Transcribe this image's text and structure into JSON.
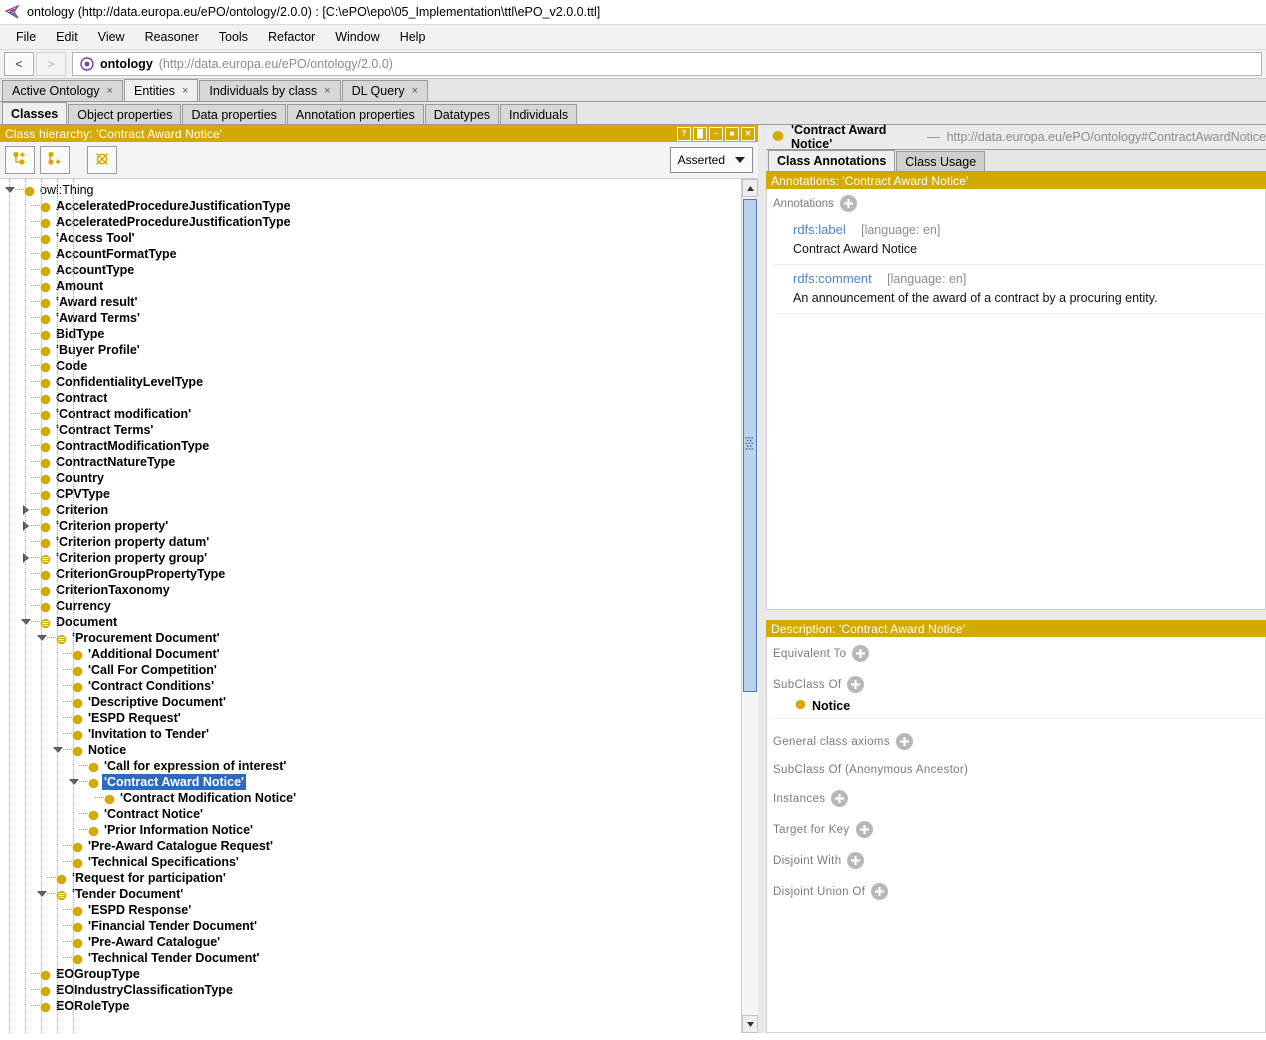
{
  "window": {
    "title": "ontology (http://data.europa.eu/ePO/ontology/2.0.0)  : [C:\\ePO\\epo\\05_Implementation\\ttl\\ePO_v2.0.0.ttl]",
    "logo_icon": "protege-logo-icon"
  },
  "menubar": [
    {
      "label": "File"
    },
    {
      "label": "Edit"
    },
    {
      "label": "View"
    },
    {
      "label": "Reasoner"
    },
    {
      "label": "Tools"
    },
    {
      "label": "Refactor"
    },
    {
      "label": "Window"
    },
    {
      "label": "Help"
    }
  ],
  "navbar": {
    "back_label": "<",
    "forward_label": ">",
    "ontology_icon": "ontology-icon",
    "ontology_name": "ontology",
    "ontology_iri": "(http://data.europa.eu/ePO/ontology/2.0.0)"
  },
  "main_tabs": [
    {
      "label": "Active Ontology",
      "close": "×",
      "selected": false
    },
    {
      "label": "Entities",
      "close": "×",
      "selected": true
    },
    {
      "label": "Individuals by class",
      "close": "×",
      "selected": false
    },
    {
      "label": "DL Query",
      "close": "×",
      "selected": false
    }
  ],
  "entity_tabs": [
    {
      "label": "Classes",
      "selected": true
    },
    {
      "label": "Object properties",
      "selected": false
    },
    {
      "label": "Data properties",
      "selected": false
    },
    {
      "label": "Annotation properties",
      "selected": false
    },
    {
      "label": "Datatypes",
      "selected": false
    },
    {
      "label": "Individuals",
      "selected": false
    }
  ],
  "hierarchy_panel": {
    "title": "Class hierarchy: 'Contract Award Notice'",
    "panel_buttons": [
      {
        "name": "help-button",
        "glyph": "?"
      },
      {
        "name": "split-button",
        "glyph": "▐▌"
      },
      {
        "name": "minimize-button",
        "glyph": "–"
      },
      {
        "name": "maximize-button",
        "glyph": "■"
      },
      {
        "name": "close-button",
        "glyph": "✕"
      }
    ],
    "toolbar": [
      {
        "name": "add-subclass-button",
        "icon": "add-subclass-icon"
      },
      {
        "name": "add-sibling-class-button",
        "icon": "add-sibling-class-icon"
      },
      {
        "name": "delete-class-button",
        "icon": "delete-class-icon"
      }
    ],
    "view_mode": "Asserted",
    "scrollbar": {
      "up_arrow": "▲",
      "down_arrow": "▼"
    }
  },
  "tree": [
    {
      "label": "owl:Thing",
      "depth": 0,
      "twisty": "open",
      "icon": "class-icon",
      "selected": false,
      "root": true
    },
    {
      "label": "AcceleratedProcedureJustificationType",
      "depth": 1,
      "twisty": "none",
      "icon": "class-icon",
      "selected": false
    },
    {
      "label": "AcceleratedProcedureJustificationType",
      "depth": 1,
      "twisty": "none",
      "icon": "class-icon",
      "selected": false
    },
    {
      "label": "'Access Tool'",
      "depth": 1,
      "twisty": "none",
      "icon": "class-icon",
      "selected": false
    },
    {
      "label": "AccountFormatType",
      "depth": 1,
      "twisty": "none",
      "icon": "class-icon",
      "selected": false
    },
    {
      "label": "AccountType",
      "depth": 1,
      "twisty": "none",
      "icon": "class-icon",
      "selected": false
    },
    {
      "label": "Amount",
      "depth": 1,
      "twisty": "none",
      "icon": "class-icon",
      "selected": false
    },
    {
      "label": "'Award result'",
      "depth": 1,
      "twisty": "none",
      "icon": "class-icon",
      "selected": false
    },
    {
      "label": "'Award Terms'",
      "depth": 1,
      "twisty": "none",
      "icon": "class-icon",
      "selected": false
    },
    {
      "label": "BidType",
      "depth": 1,
      "twisty": "none",
      "icon": "class-icon",
      "selected": false
    },
    {
      "label": "'Buyer Profile'",
      "depth": 1,
      "twisty": "none",
      "icon": "class-icon",
      "selected": false
    },
    {
      "label": "Code",
      "depth": 1,
      "twisty": "none",
      "icon": "class-icon",
      "selected": false
    },
    {
      "label": "ConfidentialityLevelType",
      "depth": 1,
      "twisty": "none",
      "icon": "class-icon",
      "selected": false
    },
    {
      "label": "Contract",
      "depth": 1,
      "twisty": "none",
      "icon": "class-icon",
      "selected": false
    },
    {
      "label": "'Contract modification'",
      "depth": 1,
      "twisty": "none",
      "icon": "class-icon",
      "selected": false
    },
    {
      "label": "'Contract Terms'",
      "depth": 1,
      "twisty": "none",
      "icon": "class-icon",
      "selected": false
    },
    {
      "label": "ContractModificationType",
      "depth": 1,
      "twisty": "none",
      "icon": "class-icon",
      "selected": false
    },
    {
      "label": "ContractNatureType",
      "depth": 1,
      "twisty": "none",
      "icon": "class-icon",
      "selected": false
    },
    {
      "label": "Country",
      "depth": 1,
      "twisty": "none",
      "icon": "class-icon",
      "selected": false
    },
    {
      "label": "CPVType",
      "depth": 1,
      "twisty": "none",
      "icon": "class-icon",
      "selected": false
    },
    {
      "label": "Criterion",
      "depth": 1,
      "twisty": "closed",
      "icon": "class-icon",
      "selected": false
    },
    {
      "label": "'Criterion property'",
      "depth": 1,
      "twisty": "closed",
      "icon": "class-icon",
      "selected": false
    },
    {
      "label": "'Criterion property datum'",
      "depth": 1,
      "twisty": "none",
      "icon": "class-icon",
      "selected": false
    },
    {
      "label": "'Criterion property group'",
      "depth": 1,
      "twisty": "closed",
      "icon": "defined-class-icon",
      "selected": false
    },
    {
      "label": "CriterionGroupPropertyType",
      "depth": 1,
      "twisty": "none",
      "icon": "class-icon",
      "selected": false
    },
    {
      "label": "CriterionTaxonomy",
      "depth": 1,
      "twisty": "none",
      "icon": "class-icon",
      "selected": false
    },
    {
      "label": "Currency",
      "depth": 1,
      "twisty": "none",
      "icon": "class-icon",
      "selected": false
    },
    {
      "label": "Document",
      "depth": 1,
      "twisty": "open",
      "icon": "defined-class-icon",
      "selected": false
    },
    {
      "label": "'Procurement Document'",
      "depth": 2,
      "twisty": "open",
      "icon": "defined-class-icon",
      "selected": false
    },
    {
      "label": "'Additional Document'",
      "depth": 3,
      "twisty": "none",
      "icon": "class-icon",
      "selected": false
    },
    {
      "label": "'Call For Competition'",
      "depth": 3,
      "twisty": "none",
      "icon": "class-icon",
      "selected": false
    },
    {
      "label": "'Contract Conditions'",
      "depth": 3,
      "twisty": "none",
      "icon": "class-icon",
      "selected": false
    },
    {
      "label": "'Descriptive Document'",
      "depth": 3,
      "twisty": "none",
      "icon": "class-icon",
      "selected": false
    },
    {
      "label": "'ESPD Request'",
      "depth": 3,
      "twisty": "none",
      "icon": "class-icon",
      "selected": false
    },
    {
      "label": "'Invitation to Tender'",
      "depth": 3,
      "twisty": "none",
      "icon": "class-icon",
      "selected": false
    },
    {
      "label": "Notice",
      "depth": 3,
      "twisty": "open",
      "icon": "class-icon",
      "selected": false
    },
    {
      "label": "'Call for expression of interest'",
      "depth": 4,
      "twisty": "none",
      "icon": "class-icon",
      "selected": false
    },
    {
      "label": "'Contract Award Notice'",
      "depth": 4,
      "twisty": "open",
      "icon": "class-icon",
      "selected": true
    },
    {
      "label": "'Contract Modification Notice'",
      "depth": 5,
      "twisty": "none",
      "icon": "class-icon",
      "selected": false
    },
    {
      "label": "'Contract Notice'",
      "depth": 4,
      "twisty": "none",
      "icon": "class-icon",
      "selected": false
    },
    {
      "label": "'Prior Information Notice'",
      "depth": 4,
      "twisty": "none",
      "icon": "class-icon",
      "selected": false
    },
    {
      "label": "'Pre-Award Catalogue Request'",
      "depth": 3,
      "twisty": "none",
      "icon": "class-icon",
      "selected": false
    },
    {
      "label": "'Technical Specifications'",
      "depth": 3,
      "twisty": "none",
      "icon": "class-icon",
      "selected": false
    },
    {
      "label": "'Request for participation'",
      "depth": 2,
      "twisty": "none",
      "icon": "class-icon",
      "selected": false
    },
    {
      "label": "'Tender Document'",
      "depth": 2,
      "twisty": "open",
      "icon": "defined-class-icon",
      "selected": false
    },
    {
      "label": "'ESPD Response'",
      "depth": 3,
      "twisty": "none",
      "icon": "class-icon",
      "selected": false
    },
    {
      "label": "'Financial Tender Document'",
      "depth": 3,
      "twisty": "none",
      "icon": "class-icon",
      "selected": false
    },
    {
      "label": "'Pre-Award Catalogue'",
      "depth": 3,
      "twisty": "none",
      "icon": "class-icon",
      "selected": false
    },
    {
      "label": "'Technical Tender Document'",
      "depth": 3,
      "twisty": "none",
      "icon": "class-icon",
      "selected": false
    },
    {
      "label": "EOGroupType",
      "depth": 1,
      "twisty": "none",
      "icon": "class-icon",
      "selected": false
    },
    {
      "label": "EOIndustryClassificationType",
      "depth": 1,
      "twisty": "none",
      "icon": "class-icon",
      "selected": false
    },
    {
      "label": "EORoleType",
      "depth": 1,
      "twisty": "none",
      "icon": "class-icon",
      "selected": false
    }
  ],
  "entity_header": {
    "icon": "class-icon",
    "name": "'Contract Award Notice'",
    "dash": "—",
    "iri": "http://data.europa.eu/ePO/ontology#ContractAwardNotice"
  },
  "annotation_tabs": [
    {
      "label": "Class Annotations",
      "selected": true
    },
    {
      "label": "Class Usage",
      "selected": false
    }
  ],
  "annotations_panel": {
    "title": "Annotations: 'Contract Award Notice'",
    "section_label": "Annotations",
    "add_icon": "plus-icon",
    "rows": [
      {
        "key": "rdfs:label",
        "lang": "[language: en]",
        "value": "Contract Award Notice"
      },
      {
        "key": "rdfs:comment",
        "lang": "[language: en]",
        "value": "An announcement of the award of a contract by a procuring entity."
      }
    ]
  },
  "description_panel": {
    "title": "Description: 'Contract Award Notice'",
    "sections": [
      {
        "label": "Equivalent To",
        "has_add": true,
        "items": []
      },
      {
        "label": "SubClass Of",
        "has_add": true,
        "items": [
          {
            "name": "Notice",
            "icon": "class-icon"
          }
        ]
      },
      {
        "label": "General class axioms",
        "has_add": true,
        "items": []
      },
      {
        "label": "SubClass Of (Anonymous Ancestor)",
        "has_add": false,
        "items": []
      },
      {
        "label": "Instances",
        "has_add": true,
        "items": []
      },
      {
        "label": "Target for Key",
        "has_add": true,
        "items": []
      },
      {
        "label": "Disjoint With",
        "has_add": true,
        "items": []
      },
      {
        "label": "Disjoint Union Of",
        "has_add": true,
        "items": []
      }
    ]
  },
  "colors": {
    "panel_title_gold": "#d4aa00",
    "class_yellow": "#d4aa00",
    "selection_blue": "#2d6bbf",
    "link_blue": "#4e7fd0",
    "scroll_thumb": "#bcd2ee"
  }
}
